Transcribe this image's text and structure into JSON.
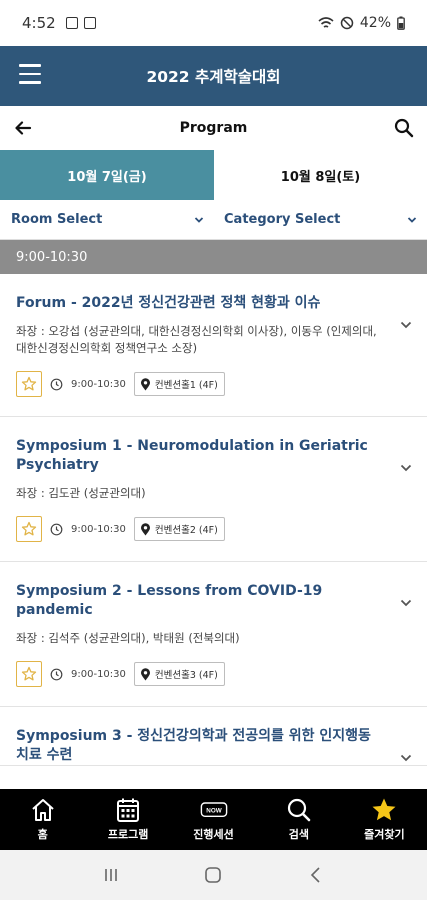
{
  "status_bar": {
    "time": "4:52",
    "battery": "42%"
  },
  "header": {
    "title": "2022 추계학술대회"
  },
  "page": {
    "title": "Program"
  },
  "date_tabs": [
    {
      "label": "10월 7일(금)",
      "active": true
    },
    {
      "label": "10월 8일(토)",
      "active": false
    }
  ],
  "filters": {
    "room": "Room Select",
    "category": "Category Select"
  },
  "time_block": {
    "label": "9:00-10:30"
  },
  "sessions": [
    {
      "title": "Forum - 2022년 정신건강관련 정책 현황과 이슈",
      "chair": "좌장 : 오강섭 (성균관의대, 대한신경정신의학회 이사장), 이동우 (인제의대, 대한신경정신의학회 정책연구소 소장)",
      "time": "9:00-10:30",
      "location": "컨벤션홀1 (4F)"
    },
    {
      "title": "Symposium 1 - Neuromodulation in Geriatric Psychiatry",
      "chair": "좌장 : 김도관 (성균관의대)",
      "time": "9:00-10:30",
      "location": "컨벤션홀2 (4F)"
    },
    {
      "title": "Symposium 2 - Lessons from COVID-19 pandemic",
      "chair": "좌장 : 김석주 (성균관의대), 박태원 (전북의대)",
      "time": "9:00-10:30",
      "location": "컨벤션홀3 (4F)"
    },
    {
      "title": "Symposium 3 - 정신건강의학과 전공의를 위한 인지행동치료 수련",
      "chair": "",
      "time": "",
      "location": ""
    }
  ],
  "bottom_nav": [
    {
      "label": "홈",
      "icon": "home-icon"
    },
    {
      "label": "프로그램",
      "icon": "calendar-icon"
    },
    {
      "label": "진행세션",
      "icon": "now-icon",
      "badge": "NOW"
    },
    {
      "label": "검색",
      "icon": "search-icon"
    },
    {
      "label": "즐겨찾기",
      "icon": "star-icon"
    }
  ],
  "colors": {
    "header": "#2f577a",
    "active_tab": "#4a8fa0",
    "title_text": "#2b4f7a",
    "time_header": "#8c8c8c",
    "star": "#f5c518"
  }
}
